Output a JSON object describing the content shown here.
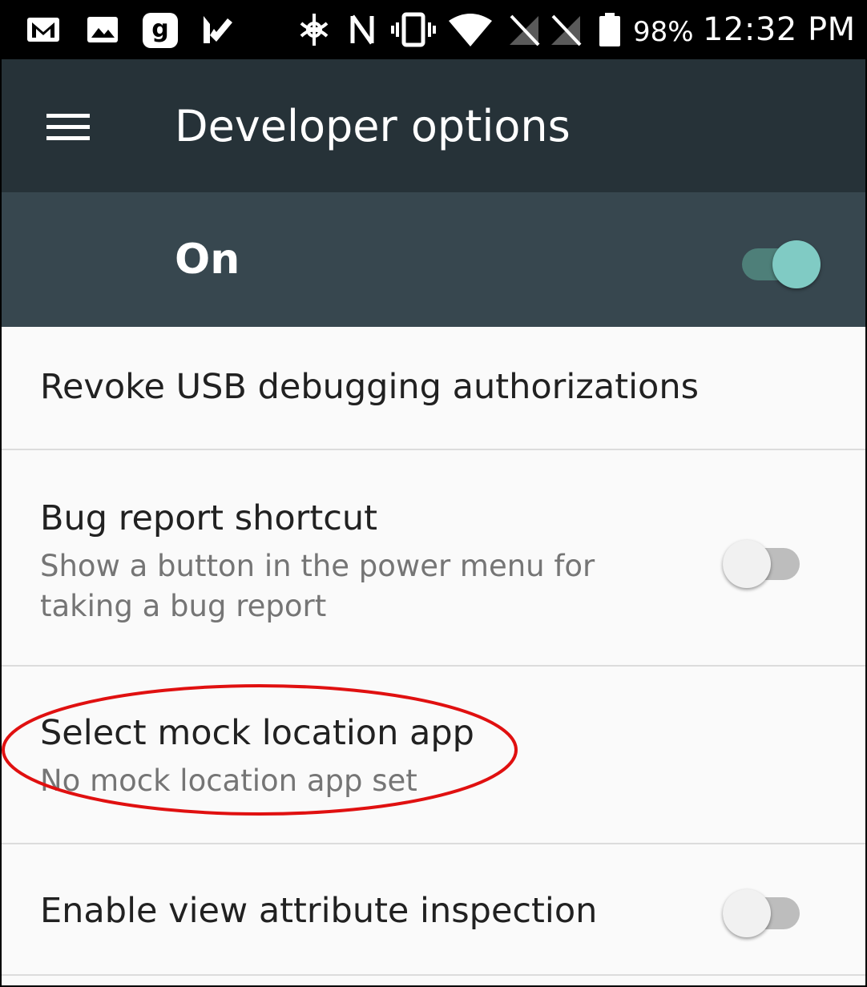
{
  "status_bar": {
    "left_icons": [
      "gmail-icon",
      "photos-icon",
      "goodreads-icon",
      "check-app-icon"
    ],
    "right_icons": [
      "tap-icon",
      "nfc-icon",
      "vibrate-icon",
      "wifi-icon",
      "no-signal-sim1-icon",
      "no-signal-sim2-icon",
      "battery-icon"
    ],
    "battery_percent": "98%",
    "time": "12:32 PM"
  },
  "app_bar": {
    "title": "Developer options",
    "nav_icon": "menu-icon"
  },
  "master_switch": {
    "label": "On",
    "checked": true
  },
  "settings": [
    {
      "title": "Revoke USB debugging authorizations"
    },
    {
      "title": "Bug report shortcut",
      "summary": "Show a button in the power menu for taking a bug report",
      "checked": false
    },
    {
      "title": "Select mock location app",
      "summary": "No mock location app set",
      "highlighted": true
    },
    {
      "title": "Enable view attribute inspection",
      "checked": false
    }
  ],
  "colors": {
    "app_bar": "#263238",
    "master_bar": "#37474f",
    "accent": "#80cbc4",
    "highlight": "#e01010"
  }
}
